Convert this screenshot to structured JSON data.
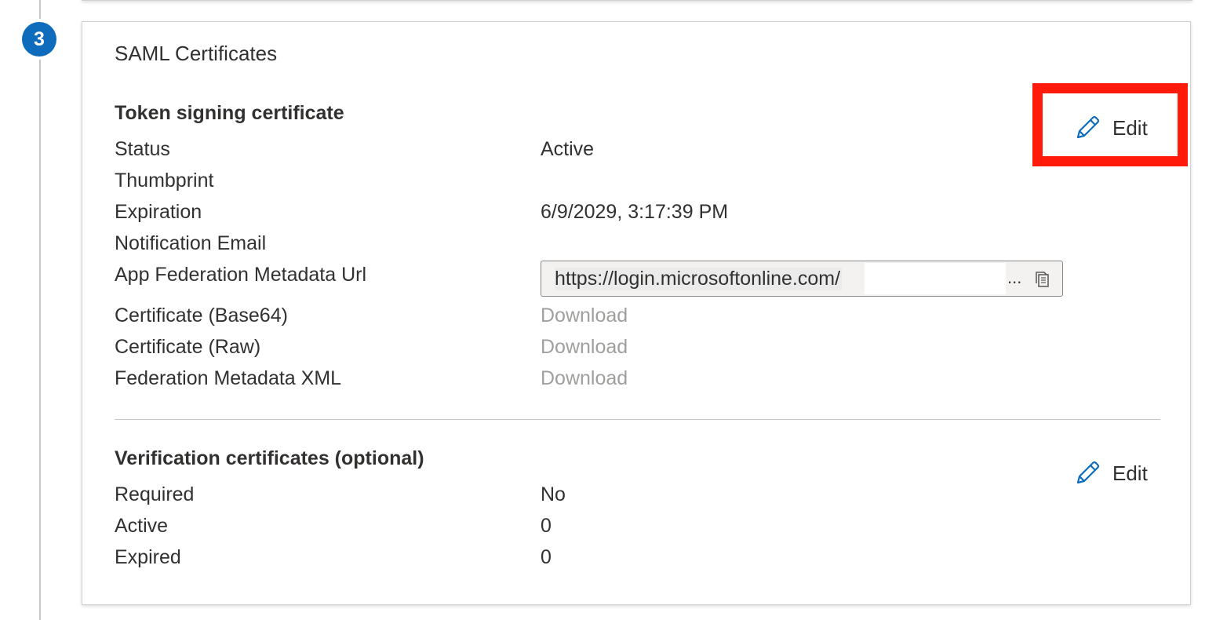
{
  "step": {
    "number": "3"
  },
  "card": {
    "title": "SAML Certificates"
  },
  "token_signing": {
    "title": "Token signing certificate",
    "edit_label": "Edit",
    "rows": {
      "status": {
        "label": "Status",
        "value": "Active"
      },
      "thumbprint": {
        "label": "Thumbprint",
        "value": ""
      },
      "expiration": {
        "label": "Expiration",
        "value": "6/9/2029, 3:17:39 PM"
      },
      "notification_email": {
        "label": "Notification Email",
        "value": ""
      },
      "metadata_url": {
        "label": "App Federation Metadata Url",
        "value": "https://login.microsoftonline.com/",
        "ellipsis": "..."
      },
      "cert_base64": {
        "label": "Certificate (Base64)",
        "value": "Download"
      },
      "cert_raw": {
        "label": "Certificate (Raw)",
        "value": "Download"
      },
      "federation_xml": {
        "label": "Federation Metadata XML",
        "value": "Download"
      }
    }
  },
  "verification": {
    "title": "Verification certificates (optional)",
    "edit_label": "Edit",
    "rows": {
      "required": {
        "label": "Required",
        "value": "No"
      },
      "active": {
        "label": "Active",
        "value": "0"
      },
      "expired": {
        "label": "Expired",
        "value": "0"
      }
    }
  },
  "colors": {
    "accent": "#0f6cbd",
    "highlight": "#ff1a0a",
    "disabled_link": "#a19f9d"
  },
  "icons": {
    "edit": "pencil-icon",
    "copy": "copy-icon"
  }
}
